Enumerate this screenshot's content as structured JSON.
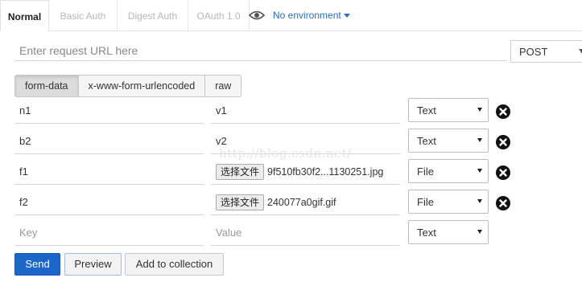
{
  "tabs": [
    {
      "label": "Normal",
      "active": true
    },
    {
      "label": "Basic Auth",
      "active": false
    },
    {
      "label": "Digest Auth",
      "active": false
    },
    {
      "label": "OAuth 1.0",
      "active": false
    }
  ],
  "environment": {
    "label": "No environment",
    "icon": "eye-icon"
  },
  "request": {
    "url_placeholder": "Enter request URL here",
    "url_value": "",
    "method": "POST"
  },
  "body_modes": [
    {
      "label": "form-data",
      "active": true
    },
    {
      "label": "x-www-form-urlencoded",
      "active": false
    },
    {
      "label": "raw",
      "active": false
    }
  ],
  "params": [
    {
      "key": "n1",
      "type": "Text",
      "value": "v1"
    },
    {
      "key": "b2",
      "type": "Text",
      "value": "v2"
    },
    {
      "key": "f1",
      "type": "File",
      "button": "选择文件",
      "filename": "9f510fb30f2...1130251.jpg"
    },
    {
      "key": "f2",
      "type": "File",
      "button": "选择文件",
      "filename": "240077a0gif.gif"
    }
  ],
  "new_row": {
    "key_placeholder": "Key",
    "value_placeholder": "Value",
    "type": "Text"
  },
  "watermark": "http://blog.csdn.net/",
  "actions": {
    "send": "Send",
    "preview": "Preview",
    "add_to_collection": "Add to collection"
  },
  "colors": {
    "accent": "#1b67c9",
    "env_link": "#2a6fb8"
  }
}
